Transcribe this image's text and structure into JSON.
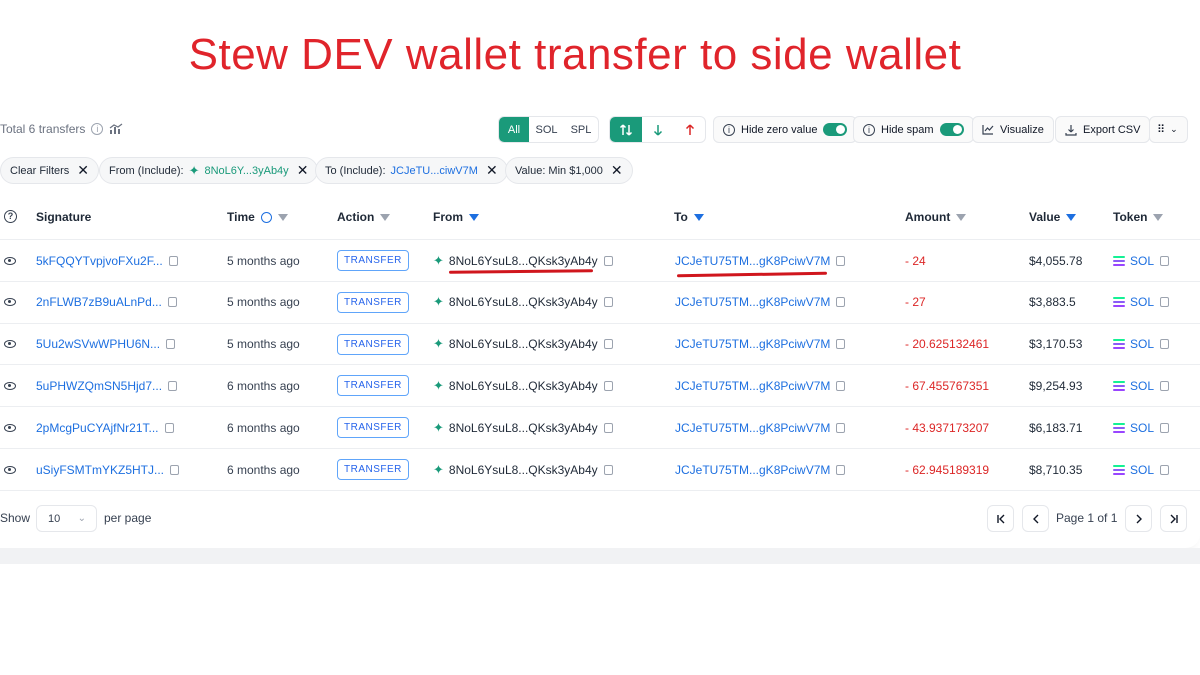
{
  "headline": "Stew DEV wallet transfer to side wallet",
  "toolbar": {
    "total_text": "Total 6 transfers",
    "filter_all": "All",
    "filter_sol": "SOL",
    "filter_spl": "SPL",
    "hide_zero_label": "Hide zero value",
    "hide_spam_label": "Hide spam",
    "visualize_label": "Visualize",
    "export_label": "Export CSV"
  },
  "chips": {
    "clear": "Clear Filters",
    "from_label": "From (Include):",
    "from_value": "8NoL6Y...3yAb4y",
    "to_label": "To (Include):",
    "to_value": "JCJeTU...ciwV7M",
    "value_label": "Value: Min $1,000"
  },
  "columns": {
    "signature": "Signature",
    "time": "Time",
    "action": "Action",
    "from": "From",
    "to": "To",
    "amount": "Amount",
    "value": "Value",
    "token": "Token"
  },
  "rows": [
    {
      "signature": "5kFQQYTvpjvoFXu2F...",
      "time": "5 months ago",
      "action": "TRANSFER",
      "from": "8NoL6YsuL8...QKsk3yAb4y",
      "to": "JCJeTU75TM...gK8PciwV7M",
      "amount": "- 24",
      "value": "$4,055.78",
      "token": "SOL"
    },
    {
      "signature": "2nFLWB7zB9uALnPd...",
      "time": "5 months ago",
      "action": "TRANSFER",
      "from": "8NoL6YsuL8...QKsk3yAb4y",
      "to": "JCJeTU75TM...gK8PciwV7M",
      "amount": "- 27",
      "value": "$3,883.5",
      "token": "SOL"
    },
    {
      "signature": "5Uu2wSVwWPHU6N...",
      "time": "5 months ago",
      "action": "TRANSFER",
      "from": "8NoL6YsuL8...QKsk3yAb4y",
      "to": "JCJeTU75TM...gK8PciwV7M",
      "amount": "- 20.625132461",
      "value": "$3,170.53",
      "token": "SOL"
    },
    {
      "signature": "5uPHWZQmSN5Hjd7...",
      "time": "6 months ago",
      "action": "TRANSFER",
      "from": "8NoL6YsuL8...QKsk3yAb4y",
      "to": "JCJeTU75TM...gK8PciwV7M",
      "amount": "- 67.455767351",
      "value": "$9,254.93",
      "token": "SOL"
    },
    {
      "signature": "2pMcgPuCYAjfNr21T...",
      "time": "6 months ago",
      "action": "TRANSFER",
      "from": "8NoL6YsuL8...QKsk3yAb4y",
      "to": "JCJeTU75TM...gK8PciwV7M",
      "amount": "- 43.937173207",
      "value": "$6,183.71",
      "token": "SOL"
    },
    {
      "signature": "uSiyFSMTmYKZ5HTJ...",
      "time": "6 months ago",
      "action": "TRANSFER",
      "from": "8NoL6YsuL8...QKsk3yAb4y",
      "to": "JCJeTU75TM...gK8PciwV7M",
      "amount": "- 62.945189319",
      "value": "$8,710.35",
      "token": "SOL"
    }
  ],
  "footer": {
    "show_label": "Show",
    "page_size": "10",
    "per_page_label": "per page",
    "page_text": "Page 1 of 1"
  },
  "colors": {
    "accent": "#1a9a7a",
    "link": "#1d6fe0",
    "negative": "#dc2626",
    "headline": "#e0242b"
  }
}
